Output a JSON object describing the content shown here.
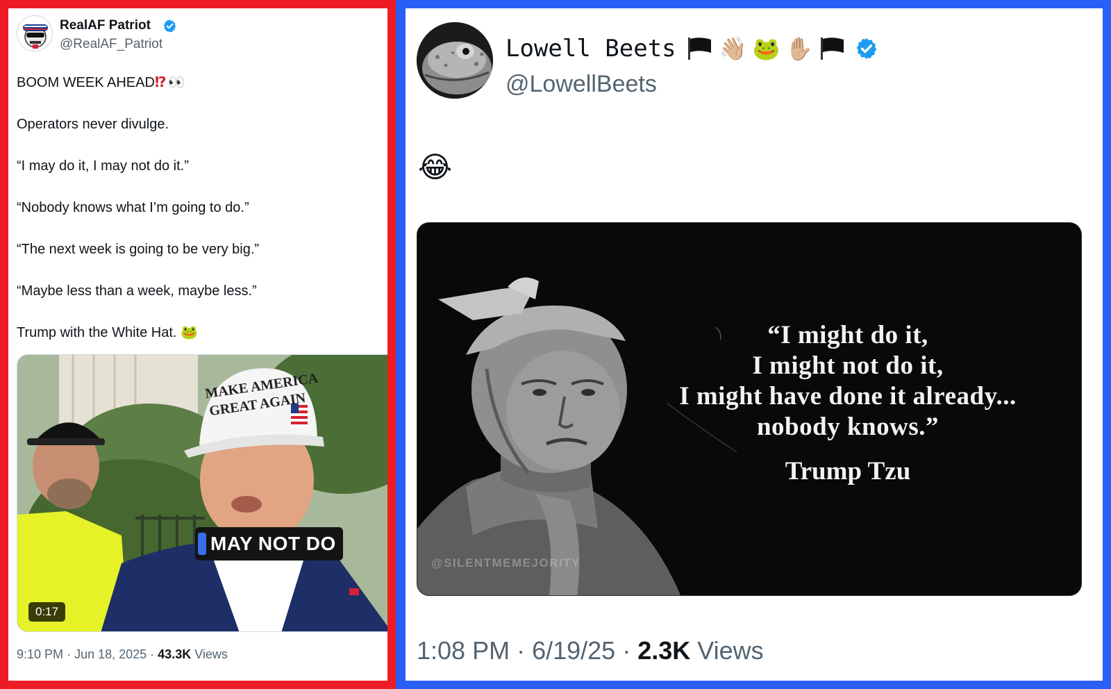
{
  "left_tweet": {
    "author": {
      "display_name": "RealAF Patriot",
      "handle": "@RealAF_Patriot",
      "verified": true
    },
    "text_lines": [
      {
        "text": "BOOM WEEK AHEAD",
        "suffix": "⁉"
      },
      {
        "text": "Operators never divulge."
      },
      {
        "text": "“I may do it, I may not do it.”"
      },
      {
        "text": "“Nobody knows what I’m going to do.”"
      },
      {
        "text": "“The next week is going to be very big.”"
      },
      {
        "text": "“Maybe less than a week, maybe less.”"
      },
      {
        "text": "Trump with the White Hat.",
        "emoji": "🐸"
      }
    ],
    "eyes_emoji": "👀",
    "video": {
      "hat_text_line1": "MAKE AMERICA",
      "hat_text_line2": "GREAT AGAIN",
      "caption": "MAY NOT DO",
      "duration": "0:17"
    },
    "meta": {
      "time": "9:10 PM",
      "date": "Jun 18, 2025",
      "views_count": "43.3K",
      "views_label": "Views"
    }
  },
  "right_tweet": {
    "author": {
      "display_name": "Lowell Beets",
      "handle": "@LowellBeets",
      "verified": true,
      "name_emojis": [
        "👋🏼",
        "🐸",
        "✋🏼"
      ]
    },
    "body_emoji": "😂",
    "image": {
      "quote_lines": [
        "“I might do it,",
        "I might not do it,",
        "I might have done it already...",
        "nobody knows.”"
      ],
      "attribution": "Trump Tzu",
      "watermark": "@SILENTMEMEJORITY"
    },
    "meta": {
      "time": "1:08 PM",
      "date": "6/19/25",
      "views_count": "2.3K",
      "views_label": "Views"
    }
  },
  "colors": {
    "left_frame": "#ed1c24",
    "right_frame": "#2a5ff5",
    "verified_blue": "#1d9bf0",
    "secondary_text": "#536471",
    "primary_text": "#0f1419"
  }
}
